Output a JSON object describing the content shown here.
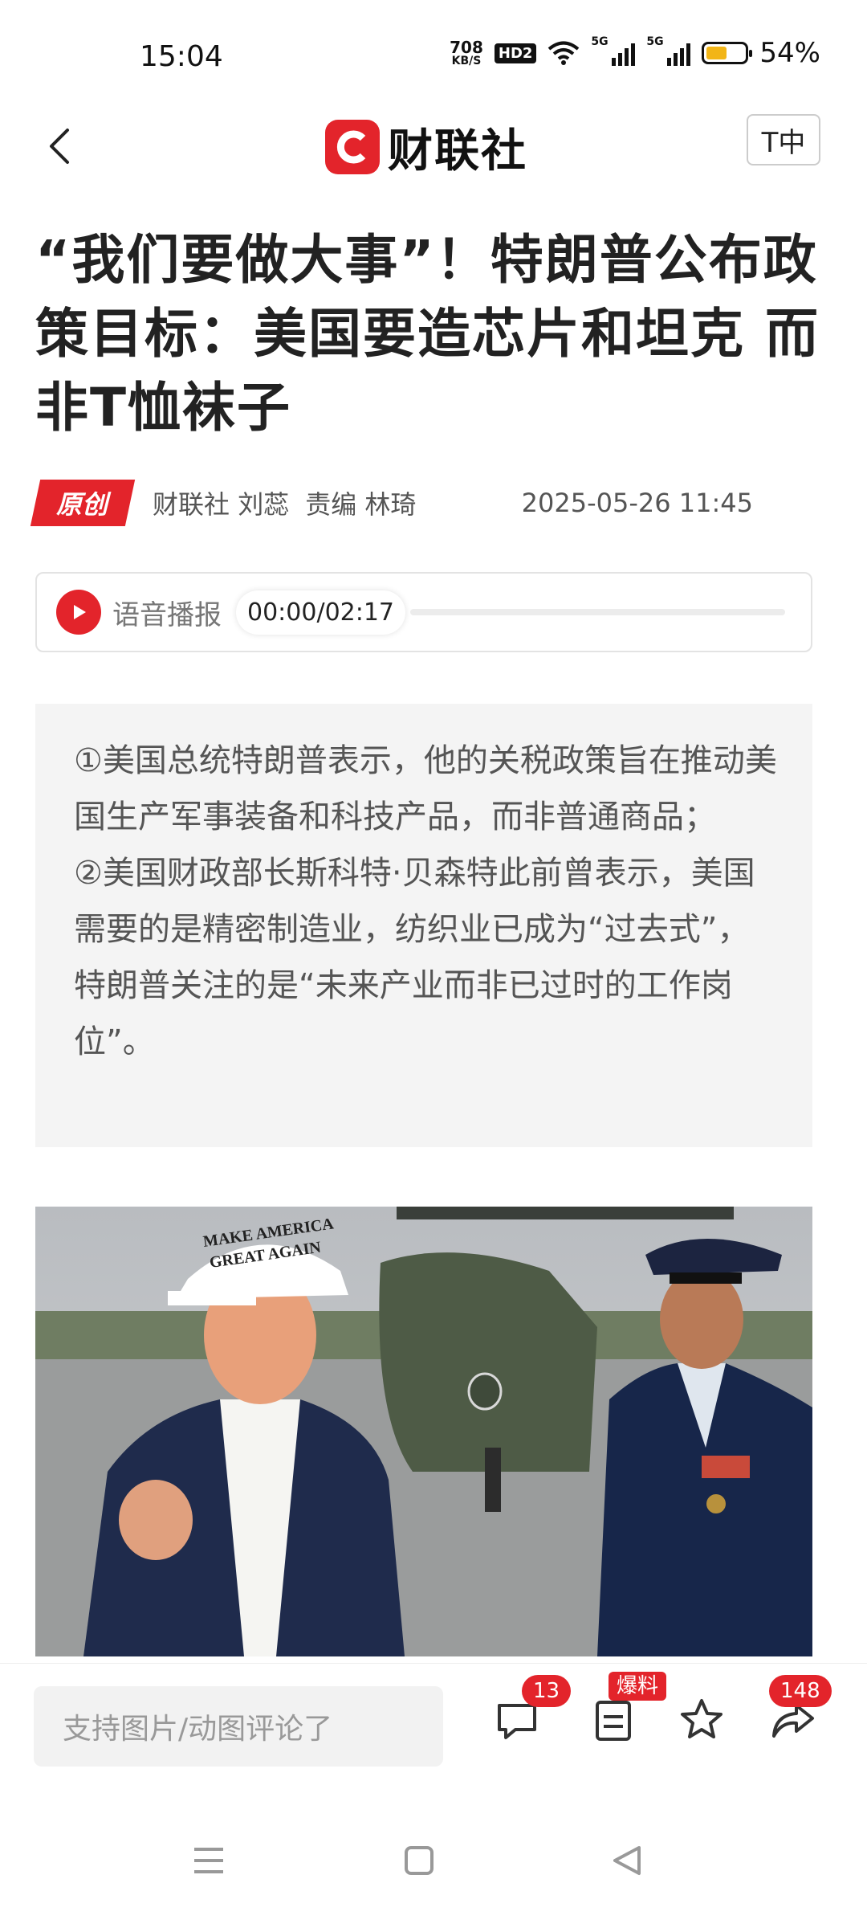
{
  "status_bar": {
    "time": "15:04",
    "net_speed": "708",
    "net_speed_unit": "KB/S",
    "hd_label": "HD2",
    "signal1_label": "5G",
    "signal2_label": "5G",
    "battery_percent": "54%",
    "battery_level": 0.54,
    "battery_color": "#f2b517"
  },
  "nav": {
    "logo_text": "财联社",
    "font_button": "T中",
    "brand_color": "#e3242b"
  },
  "article": {
    "headline": "“我们要做大事”！特朗普公布政策目标：美国要造芯片和坦克 而非T恤袜子",
    "badge": "原创",
    "source": "财联社 刘蕊",
    "editor": "责编 林琦",
    "date": "2025-05-26 11:45",
    "audio": {
      "label": "语音播报",
      "time": "00:00/02:17",
      "progress": 0
    },
    "summary": [
      "①美国总统特朗普表示，他的关税政策旨在推动美国生产军事装备和科技产品，而非普通商品；",
      "②美国财政部长斯科特·贝森特此前曾表示，美国需要的是精密制造业，纺织业已成为“过去式”，特朗普关注的是“未来产业而非已过时的工作岗位”。"
    ],
    "photo": {
      "cap_line1": "MAKE AMERICA",
      "cap_line2": "GREAT AGAIN"
    }
  },
  "bottom_bar": {
    "comment_placeholder": "支持图片/动图评论了",
    "comment_count": "13",
    "tip_label": "爆料",
    "share_count": "148"
  },
  "icons": [
    "back-arrow-icon",
    "play-icon",
    "comment-icon",
    "document-icon",
    "star-icon",
    "share-icon",
    "menu-icon",
    "home-icon",
    "back-triangle-icon"
  ]
}
